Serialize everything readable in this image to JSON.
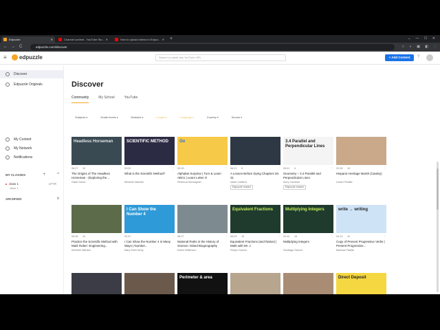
{
  "browser": {
    "tabs": [
      {
        "title": "Edpuzzle",
        "fav": "#f5a623",
        "active": true
      },
      {
        "title": "Channel content - YouTube Stu...",
        "fav": "#ff0000",
        "active": false
      },
      {
        "title": "How to upload videos to Edpuz...",
        "fav": "#ff0000",
        "active": false
      }
    ],
    "new_tab": "+",
    "url": "edpuzzle.com/discover",
    "back": "←",
    "forward": "→",
    "reload": "C",
    "ext_icons": "☆ ◐ ▣ ◧ ⋮"
  },
  "header": {
    "logo_text": "edpuzzle",
    "search_placeholder": "Search or paste any YouTube URL",
    "add_content_label": "+ Add Content",
    "help": "?"
  },
  "sidebar": {
    "items": [
      {
        "label": "Discover",
        "active": true
      },
      {
        "label": "Edpuzzle Originals",
        "active": false
      },
      {
        "label": "My Content",
        "active": false
      },
      {
        "label": "My Network",
        "active": false
      },
      {
        "label": "Notifications",
        "active": false
      }
    ],
    "classes_heading": "MY CLASSES",
    "class_name": "class 1",
    "class_code": "LP7R",
    "class_sub": "class 1",
    "archived_heading": "ARCHIVED",
    "plus": "+",
    "chevron_up": "^",
    "chevron_down": "v"
  },
  "main": {
    "title": "Discover",
    "tabs": [
      {
        "label": "Community",
        "active": true
      },
      {
        "label": "My School",
        "active": false
      },
      {
        "label": "YouTube",
        "active": false
      }
    ],
    "filters": [
      {
        "label": "Subjects",
        "muted": false
      },
      {
        "label": "Grade levels",
        "muted": false
      },
      {
        "label": "Modules",
        "muted": false
      },
      {
        "label": "Length",
        "muted": true
      },
      {
        "label": "Language",
        "muted": true
      },
      {
        "label": "Country",
        "muted": false
      },
      {
        "label": "Source",
        "muted": false
      }
    ]
  },
  "cards": [
    {
      "duration": "06:27",
      "questions": "10",
      "title": "The Origins of The Headless Horseman - (Exploring the...",
      "author": "Gabe David",
      "badge": "",
      "thumb_text": "Headless Horseman",
      "bg": "#3a4a52",
      "fg": "#dfe6e8"
    },
    {
      "duration": "03:02",
      "questions": "",
      "title": "What is the Scientific Method?",
      "author": "Michelle Warden",
      "badge": "",
      "thumb_text": "SCIENTIFIC METHOD",
      "bg": "#2b2b44",
      "fg": "#ffffff"
    },
    {
      "duration": "03:15",
      "questions": "",
      "title": "Alphabet Surprise | Turn & Learn ABCs | Learn Letter O",
      "author": "Rebecca Montagnier",
      "badge": "",
      "thumb_text": "Oo",
      "bg": "#f7c948",
      "fg": "#1d6fd8"
    },
    {
      "duration": "06:21",
      "questions": "5",
      "title": "A Lesson Before Dying Chapters 26-31",
      "author": "sarah mellkins",
      "badge": "Edpuzzle hosted",
      "thumb_text": "",
      "bg": "#2d3844",
      "fg": "#ffffff"
    },
    {
      "duration": "05:41",
      "questions": "4",
      "title": "Geometry – 3.4 Parallel and Perpendicular Lines",
      "author": "kerry Cardinal",
      "badge": "Edpuzzle hosted",
      "thumb_text": "3.4 Parallel and Perpendicular Lines",
      "bg": "#f4f4f4",
      "fg": "#222222"
    },
    {
      "duration": "22:28",
      "questions": "10",
      "title": "Hispanic Heritage Month (Cawley)",
      "author": "Lissier Padilla",
      "badge": "",
      "thumb_text": "",
      "bg": "#c9a98a",
      "fg": "#ffffff"
    },
    {
      "duration": "05:38",
      "questions": "10",
      "title": "Practice the Scientific Method with Mark Rober: Engineering...",
      "author": "Michelle Warden",
      "badge": "",
      "thumb_text": "",
      "bg": "#5c6b4a",
      "fg": "#ffffff"
    },
    {
      "duration": "02:57",
      "questions": "",
      "title": "I Can Show the Number 4 in Many Ways | Number...",
      "author": "Mary Ellen Kirby",
      "badge": "",
      "thumb_text": "I Can Show the Number 4",
      "bg": "#2e9ad8",
      "fg": "#ffffff"
    },
    {
      "duration": "08:27",
      "questions": "",
      "title": "National Parks in the History of Science: Island Biogeography",
      "author": "Karen Wilkinson",
      "badge": "",
      "thumb_text": "",
      "bg": "#7d8a8f",
      "fg": "#ffffff"
    },
    {
      "duration": "06:29",
      "questions": "10",
      "title": "Equivalent Fractions (and Ratios) | Math with Mr. J",
      "author": "Robyn Gomez",
      "badge": "",
      "thumb_text": "Equivalent Fractions",
      "bg": "#1f3b2e",
      "fg": "#c8f05a"
    },
    {
      "duration": "02:42",
      "questions": "15",
      "title": "Multiplying Integers",
      "author": "Santiago Garzon",
      "badge": "",
      "thumb_text": "Multiplying Integers",
      "bg": "#1f3b2e",
      "fg": "#c8f05a"
    },
    {
      "duration": "04:14",
      "questions": "12",
      "title": "Copy of Present Progressive Verbs | Present Progressive...",
      "author": "Marissa Padilla",
      "badge": "",
      "thumb_text": "write → writing",
      "bg": "#cfe3f7",
      "fg": "#222222"
    },
    {
      "duration": "",
      "questions": "",
      "title": "",
      "author": "",
      "badge": "",
      "thumb_text": "",
      "bg": "#3c3c46",
      "fg": "#ffffff"
    },
    {
      "duration": "",
      "questions": "",
      "title": "",
      "author": "",
      "badge": "",
      "thumb_text": "",
      "bg": "#6b5a4c",
      "fg": "#ffffff"
    },
    {
      "duration": "",
      "questions": "",
      "title": "",
      "author": "",
      "badge": "",
      "thumb_text": "Perimeter & area",
      "bg": "#111111",
      "fg": "#ffffff"
    },
    {
      "duration": "",
      "questions": "",
      "title": "",
      "author": "",
      "badge": "",
      "thumb_text": "",
      "bg": "#b8a58e",
      "fg": "#ffffff"
    },
    {
      "duration": "",
      "questions": "",
      "title": "",
      "author": "",
      "badge": "",
      "thumb_text": "",
      "bg": "#a88c74",
      "fg": "#ffffff"
    },
    {
      "duration": "",
      "questions": "",
      "title": "",
      "author": "",
      "badge": "",
      "thumb_text": "Direct Deposit",
      "bg": "#f5d742",
      "fg": "#1a1a1a"
    }
  ]
}
